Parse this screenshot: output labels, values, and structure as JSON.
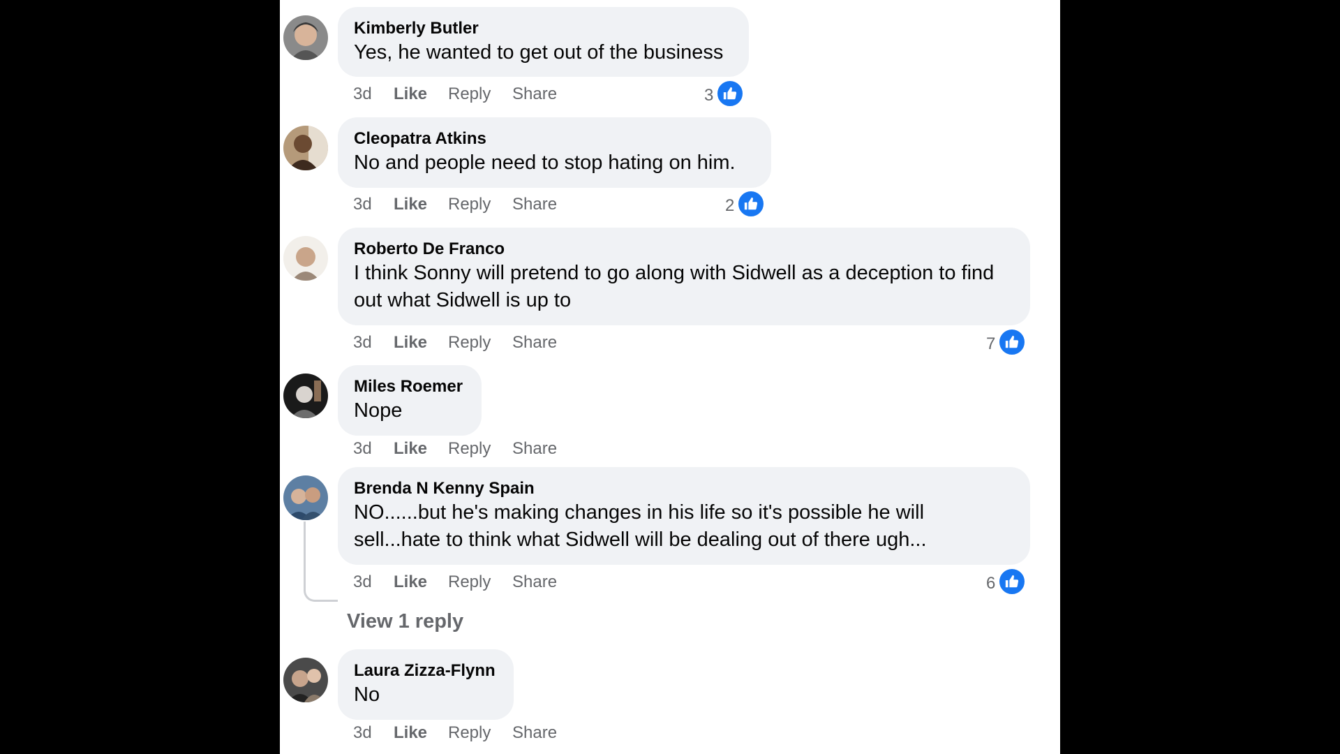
{
  "comments": [
    {
      "author": "Kimberly Butler",
      "text": "Yes, he wanted to get out of the business",
      "time": "3d",
      "like": "Like",
      "reply": "Reply",
      "share": "Share",
      "reactions": "3"
    },
    {
      "author": "Cleopatra Atkins",
      "text": "No and people need to stop hating on him.",
      "time": "3d",
      "like": "Like",
      "reply": "Reply",
      "share": "Share",
      "reactions": "2"
    },
    {
      "author": "Roberto De Franco",
      "text": "I think Sonny will pretend to go along with Sidwell as a deception to find out what Sidwell is up to",
      "time": "3d",
      "like": "Like",
      "reply": "Reply",
      "share": "Share",
      "reactions": "7"
    },
    {
      "author": "Miles Roemer",
      "text": "Nope",
      "time": "3d",
      "like": "Like",
      "reply": "Reply",
      "share": "Share"
    },
    {
      "author": "Brenda N Kenny Spain",
      "text": "NO......but he's making changes in his life so it's possible he will sell...hate to think what Sidwell will be dealing out of there ugh...",
      "time": "3d",
      "like": "Like",
      "reply": "Reply",
      "share": "Share",
      "reactions": "6",
      "view_replies": "View 1 reply"
    },
    {
      "author": "Laura Zizza-Flynn",
      "text": "No",
      "time": "3d",
      "like": "Like",
      "reply": "Reply",
      "share": "Share"
    }
  ],
  "colors": {
    "bubble": "#f0f2f5",
    "like_blue": "#1877f2",
    "secondary_text": "#65676b"
  },
  "icons": {
    "reaction": "like-thumb-icon"
  }
}
